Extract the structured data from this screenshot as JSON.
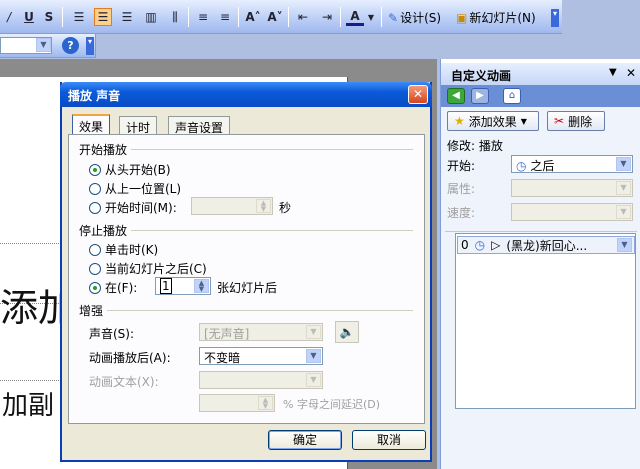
{
  "toolbar": {
    "underline": "U",
    "shadow": "S",
    "color_a": "A",
    "design_label": "设计(S)",
    "new_slide_label": "新幻灯片(N)"
  },
  "slide": {
    "title_fragment": "添加",
    "subtitle_fragment": "加副"
  },
  "dialog": {
    "title": "播放 声音",
    "close": "✕",
    "tabs": [
      "效果",
      "计时",
      "声音设置"
    ],
    "start_group": "开始播放",
    "start_options": [
      "从头开始(B)",
      "从上一位置(L)",
      "开始时间(M):"
    ],
    "seconds_label": "秒",
    "stop_group": "停止播放",
    "stop_options": [
      "单击时(K)",
      "当前幻灯片之后(C)",
      "在(F):"
    ],
    "stop_after_value": "1",
    "stop_after_suffix": "张幻灯片后",
    "enhance_group": "增强",
    "sound_label": "声音(S):",
    "sound_value": "[无声音]",
    "after_anim_label": "动画播放后(A):",
    "after_anim_value": "不变暗",
    "anim_text_label": "动画文本(X):",
    "delay_label": "% 字母之间延迟(D)",
    "ok": "确定",
    "cancel": "取消"
  },
  "pane": {
    "title": "自定义动画",
    "add_effect": "添加效果",
    "delete": "删除",
    "modify_label": "修改: 播放",
    "start_label": "开始:",
    "start_value": "之后",
    "property_label": "属性:",
    "speed_label": "速度:",
    "item_index": "0",
    "item_text": "(黑龙)新回心..."
  }
}
